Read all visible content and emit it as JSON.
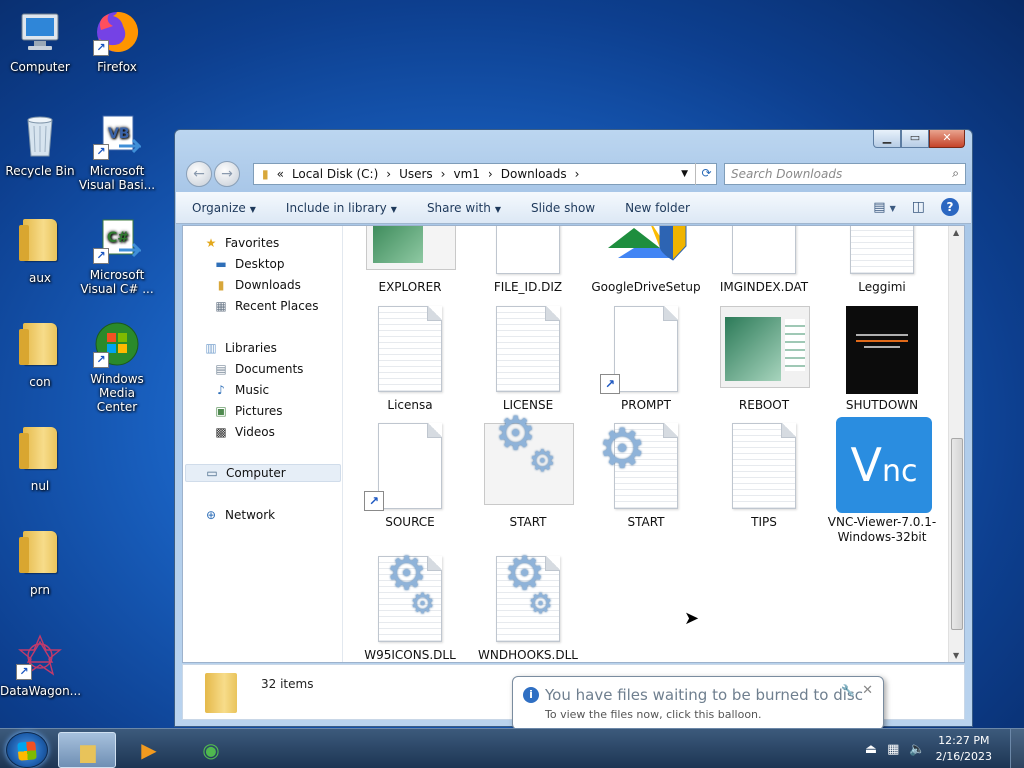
{
  "desktop": {
    "icons": [
      {
        "label": "Computer",
        "icon": "computer-icon"
      },
      {
        "label": "Firefox",
        "icon": "firefox-icon"
      },
      {
        "label": "Recycle Bin",
        "icon": "recycle-bin-icon"
      },
      {
        "label": "Microsoft Visual Basi...",
        "icon": "visual-basic-icon"
      },
      {
        "label": "aux",
        "icon": "folder-icon"
      },
      {
        "label": "Microsoft Visual C# ...",
        "icon": "visual-csharp-icon"
      },
      {
        "label": "con",
        "icon": "folder-icon"
      },
      {
        "label": "Windows Media Center",
        "icon": "media-center-icon"
      },
      {
        "label": "nul",
        "icon": "folder-icon"
      },
      {
        "label": "prn",
        "icon": "folder-icon"
      },
      {
        "label": "DataWagon...",
        "icon": "datawagon-icon"
      }
    ],
    "vb_badge": "VB",
    "cs_badge": "C#"
  },
  "window": {
    "address": {
      "prefix": "«",
      "crumbs": [
        "Local Disk (C:)",
        "Users",
        "vm1",
        "Downloads"
      ]
    },
    "search_placeholder": "Search Downloads",
    "toolbar": {
      "organize": "Organize",
      "include": "Include in library",
      "share": "Share with",
      "slideshow": "Slide show",
      "newfolder": "New folder"
    },
    "nav": {
      "favorites": "Favorites",
      "desktop": "Desktop",
      "downloads": "Downloads",
      "recent": "Recent Places",
      "libraries": "Libraries",
      "documents": "Documents",
      "music": "Music",
      "pictures": "Pictures",
      "videos": "Videos",
      "computer": "Computer",
      "network": "Network"
    },
    "files": [
      {
        "name": "EXPLORER",
        "kind": "image"
      },
      {
        "name": "FILE_ID.DIZ",
        "kind": "doc"
      },
      {
        "name": "GoogleDriveSetup",
        "kind": "installer"
      },
      {
        "name": "IMGINDEX.DAT",
        "kind": "doc"
      },
      {
        "name": "Leggimi",
        "kind": "text"
      },
      {
        "name": "Licensa",
        "kind": "text"
      },
      {
        "name": "LICENSE",
        "kind": "text"
      },
      {
        "name": "PROMPT",
        "kind": "shortcut"
      },
      {
        "name": "REBOOT",
        "kind": "image"
      },
      {
        "name": "SHUTDOWN",
        "kind": "dark-image"
      },
      {
        "name": "SOURCE",
        "kind": "shortcut"
      },
      {
        "name": "START",
        "kind": "gear-framed"
      },
      {
        "name": "START",
        "kind": "gear-doc"
      },
      {
        "name": "TIPS",
        "kind": "text"
      },
      {
        "name": "VNC-Viewer-7.0.1-Windows-32bit",
        "kind": "vnc"
      },
      {
        "name": "W95ICONS.DLL",
        "kind": "dll"
      },
      {
        "name": "WNDHOOKS.DLL",
        "kind": "dll"
      }
    ],
    "item_count": "32 items"
  },
  "balloon": {
    "title": "You have files waiting to be burned to disc",
    "message": "To view the files now, click this balloon."
  },
  "taskbar": {
    "time": "12:27 PM",
    "date": "2/16/2023"
  }
}
